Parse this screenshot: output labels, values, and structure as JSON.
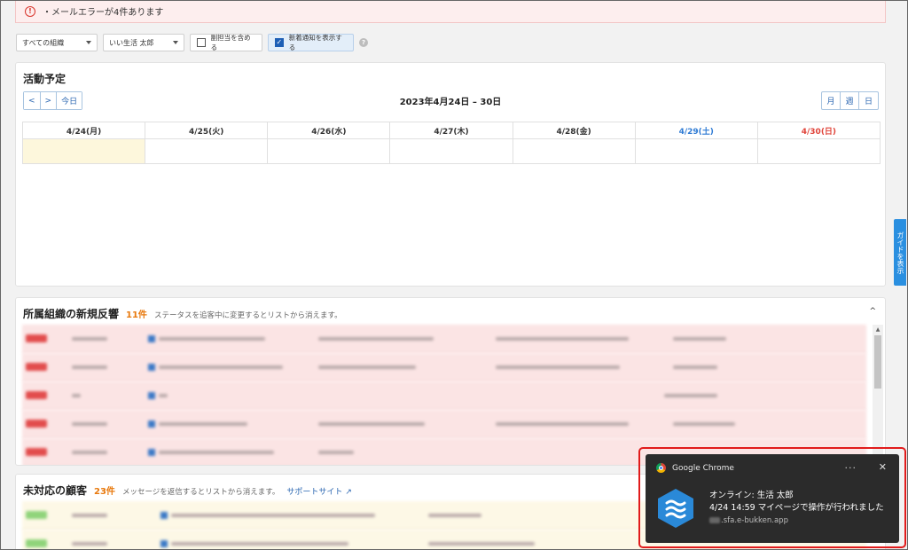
{
  "alert": {
    "text": "・メールエラーが4件あります",
    "icon": "alert-circle-icon"
  },
  "filters": {
    "org": "すべての組織",
    "user": "いい生活 太郎",
    "include_sub": "副担当を含める",
    "show_new": "新着通知を表示する",
    "help_icon": "help-icon"
  },
  "calendar": {
    "title": "活動予定",
    "prev": "<",
    "next": ">",
    "today": "今日",
    "range": "2023年4月24日 – 30日",
    "views": [
      "月",
      "週",
      "日"
    ],
    "days": [
      "4/24(月)",
      "4/25(火)",
      "4/26(水)",
      "4/27(木)",
      "4/28(金)",
      "4/29(土)",
      "4/30(日)"
    ]
  },
  "guide_tab": "ガイドを表示",
  "responses": {
    "title": "所属組織の新規反響",
    "count": "11件",
    "note": "ステータスを追客中に変更するとリストから消えます。"
  },
  "customers": {
    "title": "未対応の顧客",
    "count": "23件",
    "note": "メッセージを返信するとリストから消えます。",
    "support_link": "サポートサイト"
  },
  "notification": {
    "app_name": "Google Chrome",
    "title": "オンライン: 生活 太郎",
    "message": "4/24 14:59 マイページで操作が行われました",
    "source": ".sfa.e-bukken.app",
    "more": "···",
    "close": "✕"
  },
  "colors": {
    "accent": "#2a66b1",
    "alert_red": "#d9342b",
    "count_orange": "#e8790d",
    "notify_border": "#e11b1b"
  }
}
